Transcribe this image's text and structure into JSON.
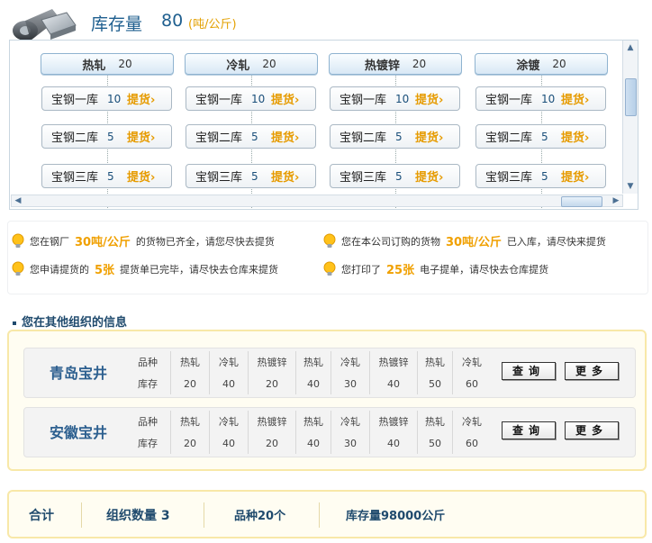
{
  "header": {
    "title": "库存量",
    "value": "80",
    "unit": "(吨/公斤)"
  },
  "stock": {
    "columns": [
      {
        "category": "热轧",
        "count": "20",
        "warehouses": [
          {
            "name": "宝钢一库",
            "qty": "10",
            "pick": "提货"
          },
          {
            "name": "宝钢二库",
            "qty": "5",
            "pick": "提货"
          },
          {
            "name": "宝钢三库",
            "qty": "5",
            "pick": "提货"
          }
        ]
      },
      {
        "category": "冷轧",
        "count": "20",
        "warehouses": [
          {
            "name": "宝钢一库",
            "qty": "10",
            "pick": "提货"
          },
          {
            "name": "宝钢二库",
            "qty": "5",
            "pick": "提货"
          },
          {
            "name": "宝钢三库",
            "qty": "5",
            "pick": "提货"
          }
        ]
      },
      {
        "category": "热镀锌",
        "count": "20",
        "warehouses": [
          {
            "name": "宝钢一库",
            "qty": "10",
            "pick": "提货"
          },
          {
            "name": "宝钢二库",
            "qty": "5",
            "pick": "提货"
          },
          {
            "name": "宝钢三库",
            "qty": "5",
            "pick": "提货"
          }
        ]
      },
      {
        "category": "涂镀",
        "count": "20",
        "warehouses": [
          {
            "name": "宝钢一库",
            "qty": "10",
            "pick": "提货"
          },
          {
            "name": "宝钢二库",
            "qty": "5",
            "pick": "提货"
          },
          {
            "name": "宝钢三库",
            "qty": "5",
            "pick": "提货"
          }
        ]
      }
    ]
  },
  "notices": [
    {
      "pre": "您在钢厂",
      "hl": "30吨/公斤",
      "post": "的货物已齐全，请您尽快去提货"
    },
    {
      "pre": "您在本公司订购的货物",
      "hl": "30吨/公斤",
      "post": "已入库，请尽快来提货"
    },
    {
      "pre": "您申请提货的",
      "hl": "5张",
      "post": "提货单已完毕，请尽快去仓库来提货"
    },
    {
      "pre": "您打印了",
      "hl": "25张",
      "post": "电子提单，请尽快去仓库提货"
    }
  ],
  "section_title": "您在其他组织的信息",
  "orgs": [
    {
      "name": "青岛宝井",
      "row1_label": "品种",
      "row2_label": "库存",
      "varieties": [
        "热轧",
        "冷轧",
        "热镀锌",
        "热轧",
        "冷轧",
        "热镀锌",
        "热轧",
        "冷轧"
      ],
      "stocks": [
        "20",
        "40",
        "20",
        "40",
        "30",
        "40",
        "50",
        "60"
      ],
      "query_label": "查询",
      "more_label": "更多"
    },
    {
      "name": "安徽宝井",
      "row1_label": "品种",
      "row2_label": "库存",
      "varieties": [
        "热轧",
        "冷轧",
        "热镀锌",
        "热轧",
        "冷轧",
        "热镀锌",
        "热轧",
        "冷轧"
      ],
      "stocks": [
        "20",
        "40",
        "20",
        "40",
        "30",
        "40",
        "50",
        "60"
      ],
      "query_label": "查询",
      "more_label": "更多"
    }
  ],
  "total": {
    "label": "合计",
    "org_count": "组织数量 3",
    "varieties": "品种20个",
    "stock": "库存量98000公斤"
  },
  "colors": {
    "accent": "#1f5f8f",
    "highlight": "#f0a000",
    "panel_border": "#f8e8a8"
  }
}
